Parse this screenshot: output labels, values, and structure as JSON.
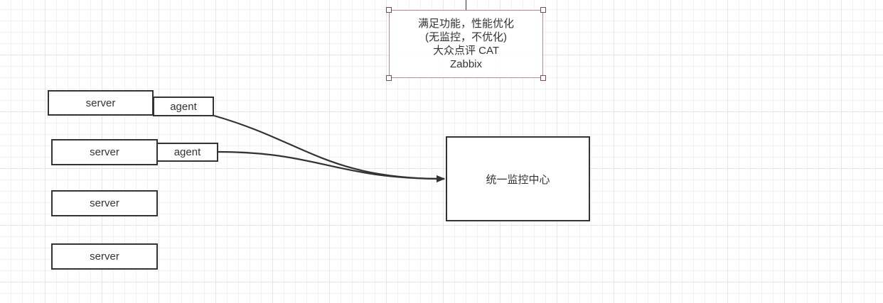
{
  "diagram": {
    "note": {
      "lines": [
        "满足功能，性能优化",
        "(无监控，不优化)",
        "大众点评 CAT",
        "Zabbix"
      ]
    },
    "servers": [
      {
        "label": "server"
      },
      {
        "label": "server"
      },
      {
        "label": "server"
      },
      {
        "label": "server"
      }
    ],
    "agents": [
      {
        "label": "agent"
      },
      {
        "label": "agent"
      }
    ],
    "center": {
      "label": "统一监控中心"
    },
    "colors": {
      "stroke": "#333333",
      "note_border": "#b98a90",
      "handle": "#7a4a52",
      "grid_major": "#e6e6e6",
      "grid_minor": "#f3f3f3"
    }
  }
}
